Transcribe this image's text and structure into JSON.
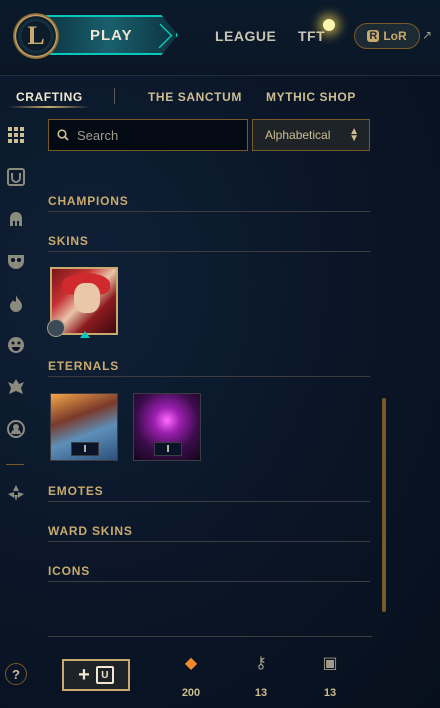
{
  "topbar": {
    "logo_letter": "L",
    "play_label": "PLAY",
    "nav": [
      "LEAGUE",
      "TFT"
    ],
    "lor_label": "LoR",
    "lor_icon_letter": "R",
    "external_arrow": "↗"
  },
  "subnav": {
    "tabs": [
      "CRAFTING",
      "THE SANCTUM",
      "MYTHIC SHOP"
    ],
    "active": "CRAFTING"
  },
  "sidebar": {
    "icons": [
      "grid-icon",
      "chest-icon",
      "helmet-icon",
      "mask-icon",
      "flame-icon",
      "emote-face-icon",
      "ward-icon",
      "profile-icon",
      "loot-arrow-icon"
    ]
  },
  "search": {
    "placeholder": "Search",
    "value": ""
  },
  "sort": {
    "selected": "Alphabetical",
    "chevron_up": "▲",
    "chevron_down": "▼"
  },
  "sections": {
    "champions": "CHAMPIONS",
    "skins": "SKINS",
    "eternals": "ETERNALS",
    "emotes": "EMOTES",
    "ward_skins": "WARD SKINS",
    "icons": "ICONS"
  },
  "eternals": [
    {
      "badge": "I"
    },
    {
      "badge": "I"
    }
  ],
  "footer": {
    "help_label": "?",
    "add_plus": "+",
    "add_box_letter": "U",
    "currencies": [
      {
        "icon": "orange-essence-icon",
        "symbol": "◆",
        "value": "200",
        "color": "#f08a2c"
      },
      {
        "icon": "key-icon",
        "symbol": "⚷",
        "value": "13",
        "color": "#a09b8c"
      },
      {
        "icon": "chest-icon",
        "symbol": "▣",
        "value": "13",
        "color": "#a09b8c"
      }
    ]
  },
  "colors": {
    "gold": "#c8aa6e",
    "teal": "#0ac8b9",
    "background": "#0a1428"
  }
}
